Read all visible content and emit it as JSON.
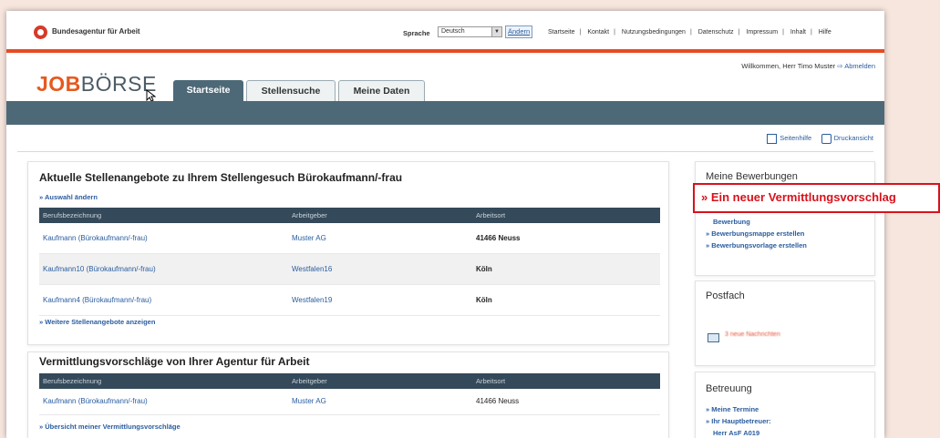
{
  "header": {
    "org_name": "Bundesagentur für Arbeit",
    "language_label": "Sprache",
    "language_value": "Deutsch",
    "language_button": "Ändern",
    "top_links": [
      "Startseite",
      "Kontakt",
      "Nutzungsbedingungen",
      "Datenschutz",
      "Impressum",
      "Inhalt",
      "Hilfe"
    ],
    "welcome": "Willkommen, Herr Timo Muster",
    "logout": "Abmelden"
  },
  "logo": {
    "part1": "JOB",
    "part2": "BÖRSE"
  },
  "tabs": [
    "Startseite",
    "Stellensuche",
    "Meine Daten"
  ],
  "toolbar": {
    "help": "Seitenhilfe",
    "print": "Druckansicht"
  },
  "offers": {
    "title": "Aktuelle Stellenangebote zu Ihrem Stellengesuch Bürokaufmann/-frau",
    "change_link": "» Auswahl ändern",
    "columns": [
      "Berufsbezeichnung",
      "Arbeitgeber",
      "Arbeitsort"
    ],
    "rows": [
      {
        "job": "Kaufmann (Bürokaufmann/-frau)",
        "employer": "Muster AG",
        "location": "41466 Neuss"
      },
      {
        "job": "Kaufmann10 (Bürokaufmann/-frau)",
        "employer": "Westfalen16",
        "location": "Köln"
      },
      {
        "job": "Kaufmann4 (Bürokaufmann/-frau)",
        "employer": "Westfalen19",
        "location": "Köln"
      }
    ],
    "more_link": "» Weitere Stellenangebote anzeigen"
  },
  "proposals": {
    "title": "Vermittlungsvorschläge von Ihrer Agentur für Arbeit",
    "columns": [
      "Berufsbezeichnung",
      "Arbeitgeber",
      "Arbeitsort"
    ],
    "rows": [
      {
        "job": "Kaufmann (Bürokaufmann/-frau)",
        "employer": "Muster AG",
        "location": "41466 Neuss"
      }
    ],
    "overview_link": "» Übersicht meiner Vermittlungsvorschläge"
  },
  "sidebar": {
    "applications_title": "Meine Bewerbungen",
    "callout": "» Ein neuer Vermittlungsvorschlag",
    "application_links": [
      "Bewerbung",
      "» Bewerbungsmappe erstellen",
      "» Bewerbungsvorlage erstellen"
    ],
    "postbox_title": "Postfach",
    "postbox_text": "3 neue Nachrichten",
    "support_title": "Betreuung",
    "support_links": [
      "» Meine Termine",
      "» Ihr Hauptbetreuer:",
      "Herr AsF A019"
    ]
  },
  "colors": {
    "accent": "#e74b22",
    "nav": "#4d6978",
    "table_header": "#34495a",
    "link": "#2a5d9f",
    "callout": "#d8121c"
  }
}
